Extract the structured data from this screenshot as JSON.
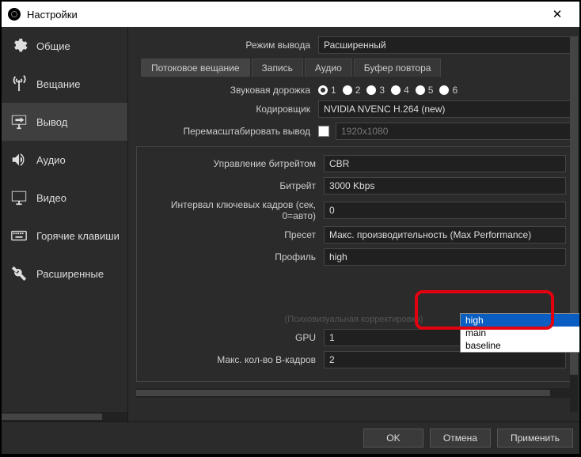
{
  "titlebar": {
    "title": "Настройки"
  },
  "sidebar": {
    "items": [
      {
        "label": "Общие"
      },
      {
        "label": "Вещание"
      },
      {
        "label": "Вывод"
      },
      {
        "label": "Аудио"
      },
      {
        "label": "Видео"
      },
      {
        "label": "Горячие клавиши"
      },
      {
        "label": "Расширенные"
      }
    ]
  },
  "content": {
    "output_mode_label": "Режим вывода",
    "output_mode_value": "Расширенный",
    "tabs": [
      {
        "label": "Потоковое вещание"
      },
      {
        "label": "Запись"
      },
      {
        "label": "Аудио"
      },
      {
        "label": "Буфер повтора"
      }
    ],
    "audio_track_label": "Звуковая дорожка",
    "audio_tracks": [
      "1",
      "2",
      "3",
      "4",
      "5",
      "6"
    ],
    "encoder_label": "Кодировщик",
    "encoder_value": "NVIDIA NVENC H.264 (new)",
    "rescale_label": "Перемасштабировать вывод",
    "rescale_value": "1920x1080",
    "rate_control_label": "Управление битрейтом",
    "rate_control_value": "CBR",
    "bitrate_label": "Битрейт",
    "bitrate_value": "3000 Kbps",
    "keyframe_label": "Интервал ключевых кадров (сек, 0=авто)",
    "keyframe_value": "0",
    "preset_label": "Пресет",
    "preset_value": "Макс. производительность (Max Performance)",
    "profile_label": "Профиль",
    "profile_value": "high",
    "profile_options": [
      "high",
      "main",
      "baseline"
    ],
    "hidden_row_text": "(Психовизуальная корректировка)",
    "gpu_label": "GPU",
    "gpu_value": "1",
    "bframes_label": "Макс. кол-во B-кадров",
    "bframes_value": "2"
  },
  "footer": {
    "ok": "OK",
    "cancel": "Отмена",
    "apply": "Применить"
  }
}
